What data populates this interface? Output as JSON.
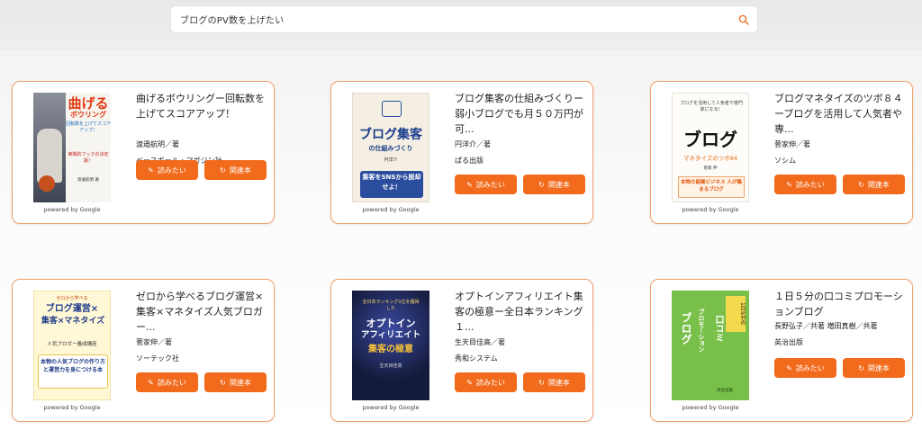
{
  "search": {
    "query": "ブログのPV数を上げたい",
    "icon": "search-icon",
    "accent": "#f26a1b"
  },
  "buttons": {
    "want_label": "読みたい",
    "want_icon": "edit-icon",
    "related_label": "関連本",
    "related_icon": "refresh-icon",
    "color": "#f26a1b"
  },
  "powered_by": "powered by Google",
  "books": [
    {
      "title": "曲げるボウリングー回転数を上げてスコアアップ！",
      "author": "渡邉航明／著",
      "publisher": "ベースボール・マガジン社",
      "cover": {
        "headline1": "曲げる",
        "headline2": "ボウリング",
        "sub": "回転数を上げてスコアアップ！",
        "tag": "実戦的フックの決定版！",
        "author_line": "渡邉航明 著"
      }
    },
    {
      "title": "ブログ集客の仕組みづくりー弱小ブログでも月５０万円が可...",
      "author": "円洋介／著",
      "publisher": "ぱる出版",
      "cover": {
        "headline1": "ブログ集客",
        "headline2": "の仕組みづくり",
        "sub": "円洋介",
        "tag": "集客をSNSから脱却せよ！",
        "author_line": ""
      }
    },
    {
      "title": "ブログマネタイズのツボ８４ーブログを活用して人気者や専...",
      "author": "菅家伸／著",
      "publisher": "ソシム",
      "cover": {
        "headline1": "ブログ",
        "headline2": "マネタイズのツボ84",
        "sub": "ブログを活用して人気者や専門家になる！",
        "tag": "本物の副業ビジネス 人が集まるブログ",
        "author_line": "菅家 伸"
      }
    },
    {
      "title": "ゼロから学べるブログ運営×集客×マネタイズ人気ブロガー...",
      "author": "菅家伸／著",
      "publisher": "ソーテック社",
      "cover": {
        "headline1": "ブログ運営×",
        "headline2": "集客×マネタイズ",
        "sub": "人気ブロガー養成講座",
        "tag": "本物の人気ブログの作り方と運営力を身につける本",
        "author_line": "ゼロから学べる"
      }
    },
    {
      "title": "オプトインアフィリエイト集客の極意ー全日本ランキング１...",
      "author": "生天目佳高／著",
      "publisher": "秀和システム",
      "cover": {
        "headline1": "オプトイン",
        "headline2": "アフィリエイト",
        "sub": "集客の極意",
        "tag": "全日本ランキング1位を獲得した",
        "author_line": "生天目佳高"
      }
    },
    {
      "title": "１日５分の口コミプロモーションブログ",
      "author": "長野弘子／共著 増田真樹／共著",
      "publisher": "英治出版",
      "cover": {
        "headline1": "口コミ",
        "headline2": "プロモーション",
        "sub": "ブログ",
        "tag": "1日5分の",
        "author_line": "英治出版"
      }
    }
  ]
}
